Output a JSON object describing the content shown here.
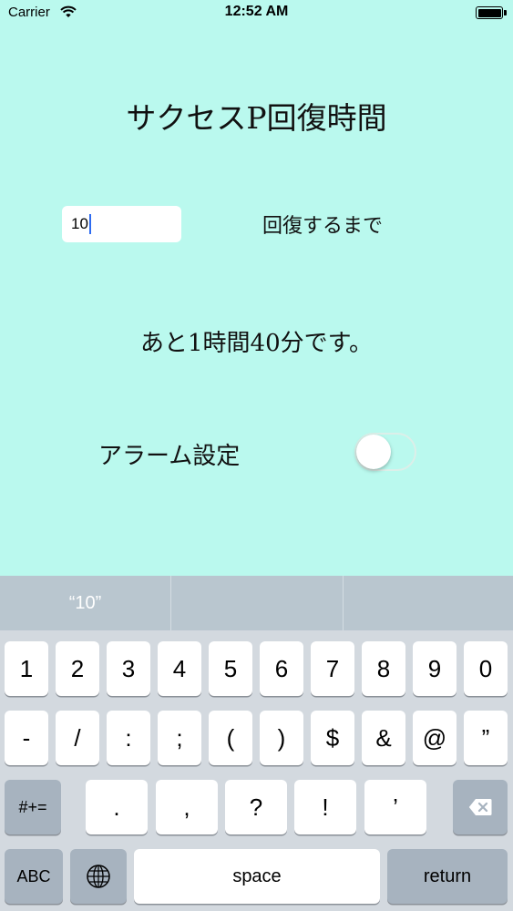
{
  "status_bar": {
    "carrier": "Carrier",
    "time": "12:52 AM"
  },
  "app": {
    "title": "サクセスP回復時間",
    "input_value": "10",
    "until_label": "回復するまで",
    "remaining_text": "あと1時間40分です。",
    "alarm_label": "アラーム設定",
    "alarm_on": false
  },
  "keyboard": {
    "suggestion": "“10”",
    "row1": [
      "1",
      "2",
      "3",
      "4",
      "5",
      "6",
      "7",
      "8",
      "9",
      "0"
    ],
    "row2": [
      "-",
      "/",
      ":",
      ";",
      "(",
      ")",
      "$",
      "&",
      "@",
      "”"
    ],
    "row3_mode": "#+=",
    "row3": [
      ".",
      ",",
      "?",
      "!",
      "’"
    ],
    "abc": "ABC",
    "space": "space",
    "return": "return"
  },
  "icons": {
    "wifi": "wifi-icon",
    "battery": "battery-icon",
    "globe": "globe-icon",
    "delete": "delete-backspace-icon"
  }
}
